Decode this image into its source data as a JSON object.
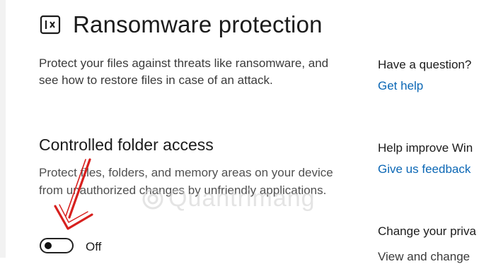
{
  "header": {
    "title": "Ransomware protection",
    "icon": "ransomware-shield-icon"
  },
  "intro": {
    "text": "Protect your files against threats like ransomware, and see how to restore files in case of an attack."
  },
  "controlled_folder_access": {
    "title": "Controlled folder access",
    "description": "Protect files, folders, and memory areas on your device from unauthorized changes by unfriendly applications.",
    "toggle_state": "Off",
    "toggle_on": false
  },
  "sidebar": {
    "question_heading": "Have a question?",
    "get_help_link": "Get help",
    "improve_heading": "Help improve Win",
    "feedback_link": "Give us feedback",
    "privacy_heading": "Change your priva",
    "privacy_partial": "View and change"
  },
  "overlay": {
    "watermark_text": "Quantrimang",
    "arrow_color": "#d7201e"
  },
  "colors": {
    "link": "#0b67b5",
    "text": "#1b1b1b",
    "muted": "#505050"
  }
}
